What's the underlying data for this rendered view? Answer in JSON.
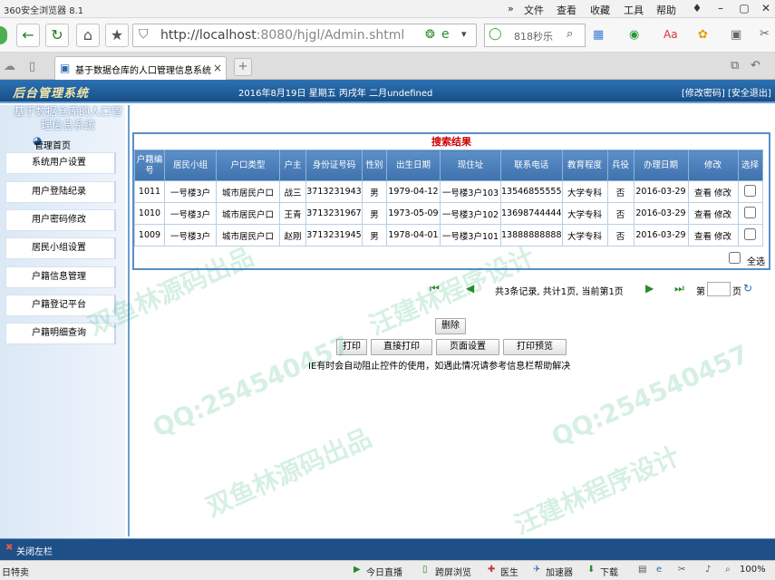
{
  "browser": {
    "title": "360安全浏览器 8.1",
    "menus": [
      "文件",
      "查看",
      "收藏",
      "工具",
      "帮助"
    ],
    "url_host": "http://localhost",
    "url_rest": ":8080/hjgl/Admin.shtml",
    "search_text": "818秒乐",
    "tab_title": "基于数据仓库的人口管理信息系统",
    "tab_close": "×",
    "new_tab": "+"
  },
  "header": {
    "logo": "后台管理系统",
    "date_text": "2016年8月19日 星期五 丙戌年 二月undefined",
    "links": "[修改密码] [安全退出]"
  },
  "sidebar": {
    "system_title": "基于数据仓库的人口管理信息系统",
    "home": "管理首页",
    "items": [
      {
        "label": "系统用户设置"
      },
      {
        "label": "用户登陆纪录"
      },
      {
        "label": "用户密码修改"
      },
      {
        "label": "居民小组设置"
      },
      {
        "label": "户籍信息管理"
      },
      {
        "label": "户籍登记平台"
      },
      {
        "label": "户籍明细查询"
      }
    ]
  },
  "results": {
    "title": "搜索结果",
    "columns": [
      "户籍编号",
      "居民小组",
      "户口类型",
      "户主",
      "身份证号码",
      "性别",
      "出生日期",
      "现住址",
      "联系电话",
      "教育程度",
      "兵役",
      "办理日期",
      "修改",
      "选择"
    ],
    "rows": [
      {
        "id": "1011",
        "group": "一号楼3户",
        "type": "城市居民户口",
        "head": "战三",
        "idno": "3713231943",
        "sex": "男",
        "birth": "1979-04-12",
        "addr": "一号楼3户103",
        "phone": "13546855555",
        "edu": "大学专科",
        "mil": "否",
        "date": "2016-03-29",
        "view": "查看",
        "edit": "修改"
      },
      {
        "id": "1010",
        "group": "一号楼3户",
        "type": "城市居民户口",
        "head": "王青",
        "idno": "3713231967",
        "sex": "男",
        "birth": "1973-05-09",
        "addr": "一号楼3户102",
        "phone": "13698744444",
        "edu": "大学专科",
        "mil": "否",
        "date": "2016-03-29",
        "view": "查看",
        "edit": "修改"
      },
      {
        "id": "1009",
        "group": "一号楼3户",
        "type": "城市居民户口",
        "head": "赵刚",
        "idno": "3713231945",
        "sex": "男",
        "birth": "1978-04-01",
        "addr": "一号楼3户101",
        "phone": "13888888888",
        "edu": "大学专科",
        "mil": "否",
        "date": "2016-03-29",
        "view": "查看",
        "edit": "修改"
      }
    ],
    "select_all": "全选"
  },
  "pager": {
    "summary": "共3条记录, 共计1页, 当前第1页",
    "goto_prefix": "第",
    "goto_suffix": "页"
  },
  "actions": {
    "delete": "删除",
    "print": "打印",
    "direct_print": "直接打印",
    "page_setup": "页面设置",
    "print_preview": "打印预览",
    "note": "IE有时会自动阻止控件的使用，如遇此情况请参考信息栏帮助解决"
  },
  "bottom": {
    "close_left": "关闭左栏"
  },
  "statusbar": {
    "left": "日特卖",
    "items": [
      "今日直播",
      "跨屏浏览",
      "医生",
      "加速器",
      "下载"
    ],
    "zoom": "100%"
  },
  "watermarks": [
    "双鱼林源码出品",
    "QQ:254540457",
    "汪建林程序设计"
  ],
  "colors": {
    "accent": "#1e4f86",
    "header_cell": "#4a7fb9",
    "title_red": "#cc0000"
  }
}
